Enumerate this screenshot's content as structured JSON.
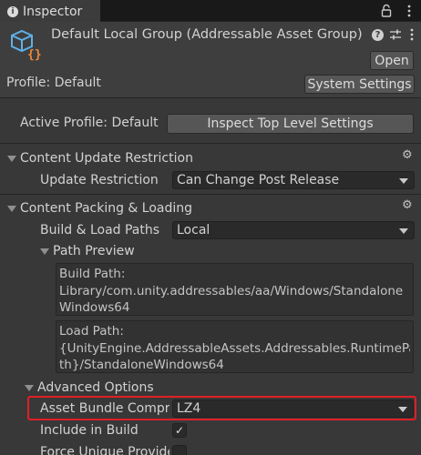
{
  "tab": {
    "title": "Inspector",
    "info_icon": "info-icon"
  },
  "header": {
    "title": "Default Local Group (Addressable Asset Group)",
    "open_label": "Open",
    "profile_label": "Profile: Default",
    "system_settings_label": "System Settings"
  },
  "profile": {
    "active_profile_label": "Active Profile: Default",
    "inspect_button_label": "Inspect Top Level Settings"
  },
  "content_update": {
    "title": "Content Update Restriction",
    "update_restriction_label": "Update Restriction",
    "update_restriction_value": "Can Change Post Release"
  },
  "content_packing": {
    "title": "Content Packing & Loading",
    "build_load_paths_label": "Build & Load Paths",
    "build_load_paths_value": "Local",
    "path_preview_label": "Path Preview",
    "build_path_heading": "Build Path:",
    "build_path_line1": "Library/com.unity.addressables/aa/Windows/Standalone",
    "build_path_line2": "Windows64",
    "load_path_heading": "Load Path:",
    "load_path_line1": "{UnityEngine.AddressableAssets.Addressables.RuntimePa",
    "load_path_line2": "th}/StandaloneWindows64",
    "advanced_options_label": "Advanced Options",
    "asset_bundle_compression_label": "Asset Bundle Compression",
    "asset_bundle_compression_value": "LZ4",
    "include_in_build_label": "Include in Build",
    "include_in_build_checked": true,
    "force_unique_provider_label": "Force Unique Provider",
    "force_unique_provider_checked": false
  },
  "colors": {
    "highlight": "#e01f26",
    "background": "#383838",
    "field": "#2a2a2a",
    "button": "#565656",
    "group_icon": "#5fb1e8",
    "group_icon_accent": "#f08a3c"
  }
}
